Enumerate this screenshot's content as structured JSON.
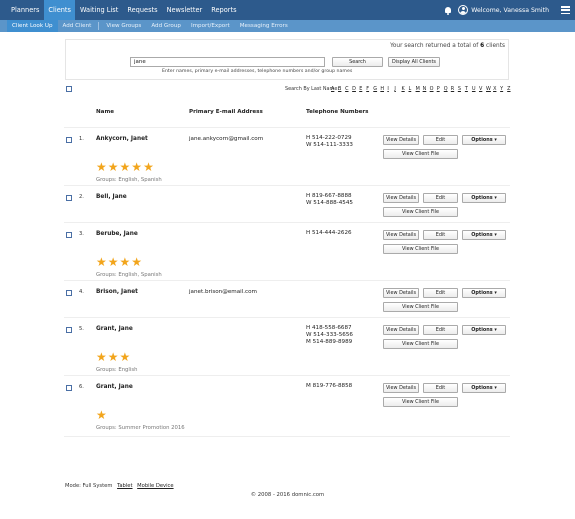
{
  "top_nav": [
    "Planners",
    "Clients",
    "Waiting List",
    "Requests",
    "Newsletter",
    "Reports"
  ],
  "user": {
    "welcome": "Welcome, Vanessa Smith"
  },
  "sub_nav": [
    "Client Look Up",
    "Add Client",
    "View Groups",
    "Add Group",
    "Import/Export",
    "Messaging Errors"
  ],
  "search": {
    "summary_prefix": "Your search returned a total of",
    "summary_count": "6",
    "summary_suffix": "clients",
    "value": "jane",
    "search_label": "Search",
    "display_all_label": "Display All Clients",
    "hint": "Enter names, primary e-mail addresses, telephone numbers and/or group names"
  },
  "alpha": {
    "label": "Search By Last Name:",
    "letters": [
      "A",
      "B",
      "C",
      "D",
      "E",
      "F",
      "G",
      "H",
      "I",
      "J",
      "K",
      "L",
      "M",
      "N",
      "O",
      "P",
      "Q",
      "R",
      "S",
      "T",
      "U",
      "V",
      "W",
      "X",
      "Y",
      "Z"
    ]
  },
  "columns": {
    "name": "Name",
    "email": "Primary E-mail Address",
    "phone": "Telephone Numbers"
  },
  "buttons": {
    "details": "View Details",
    "edit": "Edit",
    "options": "Options ▾",
    "file": "View Client File"
  },
  "clients": [
    {
      "num": "1.",
      "name": "Ankycorn, Janet",
      "email": "jane.ankycorn@gmail.com",
      "phones": [
        "H 514-222-0729",
        "W 514-111-3333"
      ],
      "stars": 5,
      "groups": "Groups: English, Spanish"
    },
    {
      "num": "2.",
      "name": "Bell, Jane",
      "email": "",
      "phones": [
        "H 819-667-8888",
        "W 514-888-4545"
      ],
      "stars": 0,
      "groups": ""
    },
    {
      "num": "3.",
      "name": "Berube, Jane",
      "email": "",
      "phones": [
        "H 514-444-2626"
      ],
      "stars": 4,
      "groups": "Groups: English, Spanish"
    },
    {
      "num": "4.",
      "name": "Brison, Janet",
      "email": "janet.brison@email.com",
      "phones": [],
      "stars": 0,
      "groups": ""
    },
    {
      "num": "5.",
      "name": "Grant, Jane",
      "email": "",
      "phones": [
        "H 418-558-6687",
        "W 514-333-5656",
        "M 514-889-8989"
      ],
      "stars": 3,
      "groups": "Groups: English"
    },
    {
      "num": "6.",
      "name": "Grant, Jane",
      "email": "",
      "phones": [
        "M 819-776-8858"
      ],
      "stars": 1,
      "groups": "Groups: Summer Promotion 2016"
    }
  ],
  "footer": {
    "mode_label": "Mode: Full System",
    "tablet": "Tablet",
    "mobile": "Mobile Device",
    "copyright": "© 2008 - 2016 domnic.com"
  }
}
